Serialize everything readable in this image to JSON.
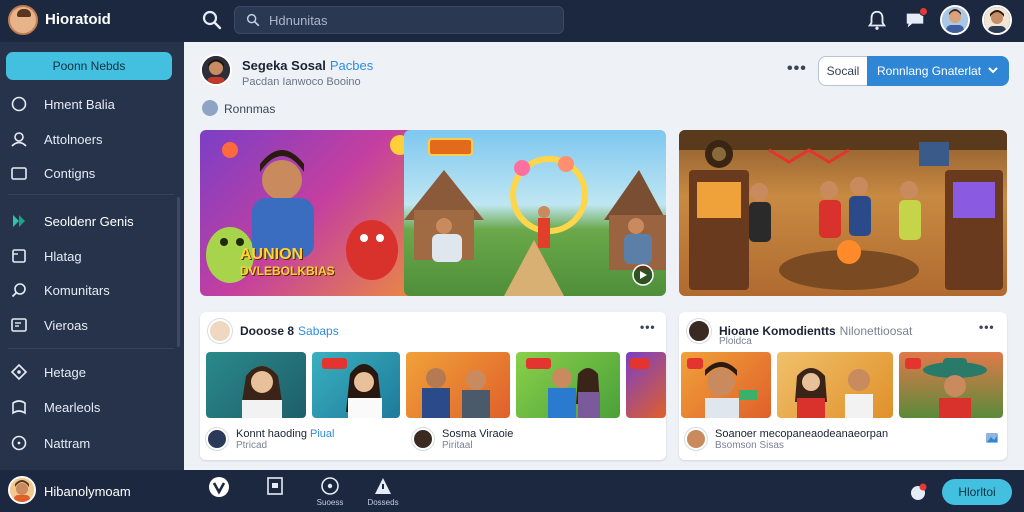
{
  "app": {
    "title": "Hioratoid"
  },
  "search": {
    "placeholder": "Hdnunitas"
  },
  "sidebar": {
    "cta_label": "Poonn Nebds",
    "items": [
      {
        "label": "Hment Balia",
        "icon": "home-icon"
      },
      {
        "label": "Attolnoers",
        "icon": "people-icon"
      },
      {
        "label": "Contigns",
        "icon": "folder-icon"
      },
      {
        "label": "Seoldenr Genis",
        "icon": "play-icon"
      },
      {
        "label": "Hlatag",
        "icon": "tag-icon"
      },
      {
        "label": "Komunitars",
        "icon": "search-icon"
      },
      {
        "label": "Vieroas",
        "icon": "video-icon"
      },
      {
        "label": "Hetage",
        "icon": "compass-icon"
      },
      {
        "label": "Mearleols",
        "icon": "bookmark-icon"
      },
      {
        "label": "Nattram",
        "icon": "clock-icon"
      }
    ]
  },
  "channel": {
    "name": "Segeka Sosal",
    "tag": "Pacbes",
    "subtitle": "Pacdan Ianwoco Booino",
    "social_label": "Socail",
    "primary_label": "Ronnlang Gnaterlat"
  },
  "section": {
    "label": "Ronnmas"
  },
  "hero": {
    "label_line1": "AUNION",
    "label_line2": "DVLEBOLKBIAS"
  },
  "cards": [
    {
      "title": "Dooose 8",
      "tag": "Sabaps",
      "footer_title": "Konnt haoding",
      "footer_tag": "Piual",
      "footer_sub": "Ptricad"
    },
    {
      "footer_title": "Sosma Viraoie",
      "footer_sub": "Piritaal"
    },
    {
      "title": "Hioane Komodientts",
      "tag": "Nilonettioosat",
      "subtitle": "Ploidca",
      "footer_title": "Soanoer mecopaneaodeanaeorpan",
      "footer_sub": "Bsomson Sisas"
    }
  ],
  "user": {
    "name": "Hibanolymoam"
  },
  "dock": {
    "items": [
      {
        "label": "",
        "icon": "v-logo-icon"
      },
      {
        "label": "",
        "icon": "document-icon"
      },
      {
        "label": "Suoess",
        "icon": "circle-play-icon"
      },
      {
        "label": "Dosseds",
        "icon": "alert-icon"
      }
    ],
    "main_button": "Hlorltoi"
  },
  "colors": {
    "topbar": "#1c2840",
    "sidebar": "#26334b",
    "accent": "#43c0e0",
    "primary": "#2f86d4",
    "main_bg": "#eef1f6"
  }
}
